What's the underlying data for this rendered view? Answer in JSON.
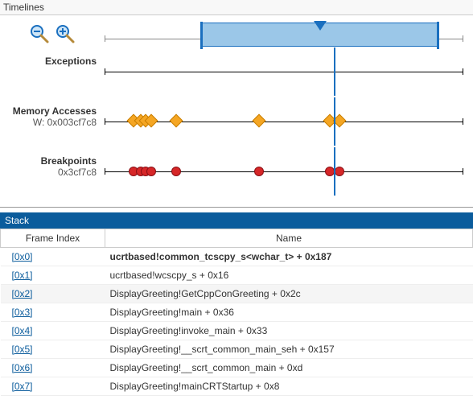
{
  "timelines": {
    "title": "Timelines",
    "overview": {
      "range_start_pct": 27,
      "range_end_pct": 93,
      "marker_pct": 60
    },
    "cursor_pct": 64,
    "tracks": [
      {
        "title": "Exceptions",
        "sub": "",
        "marker_type": "none",
        "positions_pct": []
      },
      {
        "title": "Memory Accesses",
        "sub": "W: 0x003cf7c8",
        "marker_type": "diamond",
        "positions_pct": [
          8,
          10,
          11.5,
          13,
          20,
          43,
          62.8,
          65.4
        ]
      },
      {
        "title": "Breakpoints",
        "sub": "0x3cf7c8",
        "marker_type": "circle",
        "positions_pct": [
          8,
          10,
          11.5,
          13,
          20,
          43,
          62.8,
          65.4
        ]
      }
    ]
  },
  "stack": {
    "title": "Stack",
    "columns": {
      "frame_index": "Frame Index",
      "name": "Name"
    },
    "frames": [
      {
        "idx": "[0x0]",
        "name": "ucrtbased!common_tcscpy_s<wchar_t> + 0x187",
        "current": true
      },
      {
        "idx": "[0x1]",
        "name": "ucrtbased!wcscpy_s + 0x16"
      },
      {
        "idx": "[0x2]",
        "name": "DisplayGreeting!GetCppConGreeting + 0x2c",
        "selected": true
      },
      {
        "idx": "[0x3]",
        "name": "DisplayGreeting!main + 0x36"
      },
      {
        "idx": "[0x4]",
        "name": "DisplayGreeting!invoke_main + 0x33"
      },
      {
        "idx": "[0x5]",
        "name": "DisplayGreeting!__scrt_common_main_seh + 0x157"
      },
      {
        "idx": "[0x6]",
        "name": "DisplayGreeting!__scrt_common_main + 0xd"
      },
      {
        "idx": "[0x7]",
        "name": "DisplayGreeting!mainCRTStartup + 0x8"
      }
    ]
  },
  "icons": {
    "zoom_out": "zoom-out-icon",
    "zoom_in": "zoom-in-icon"
  }
}
